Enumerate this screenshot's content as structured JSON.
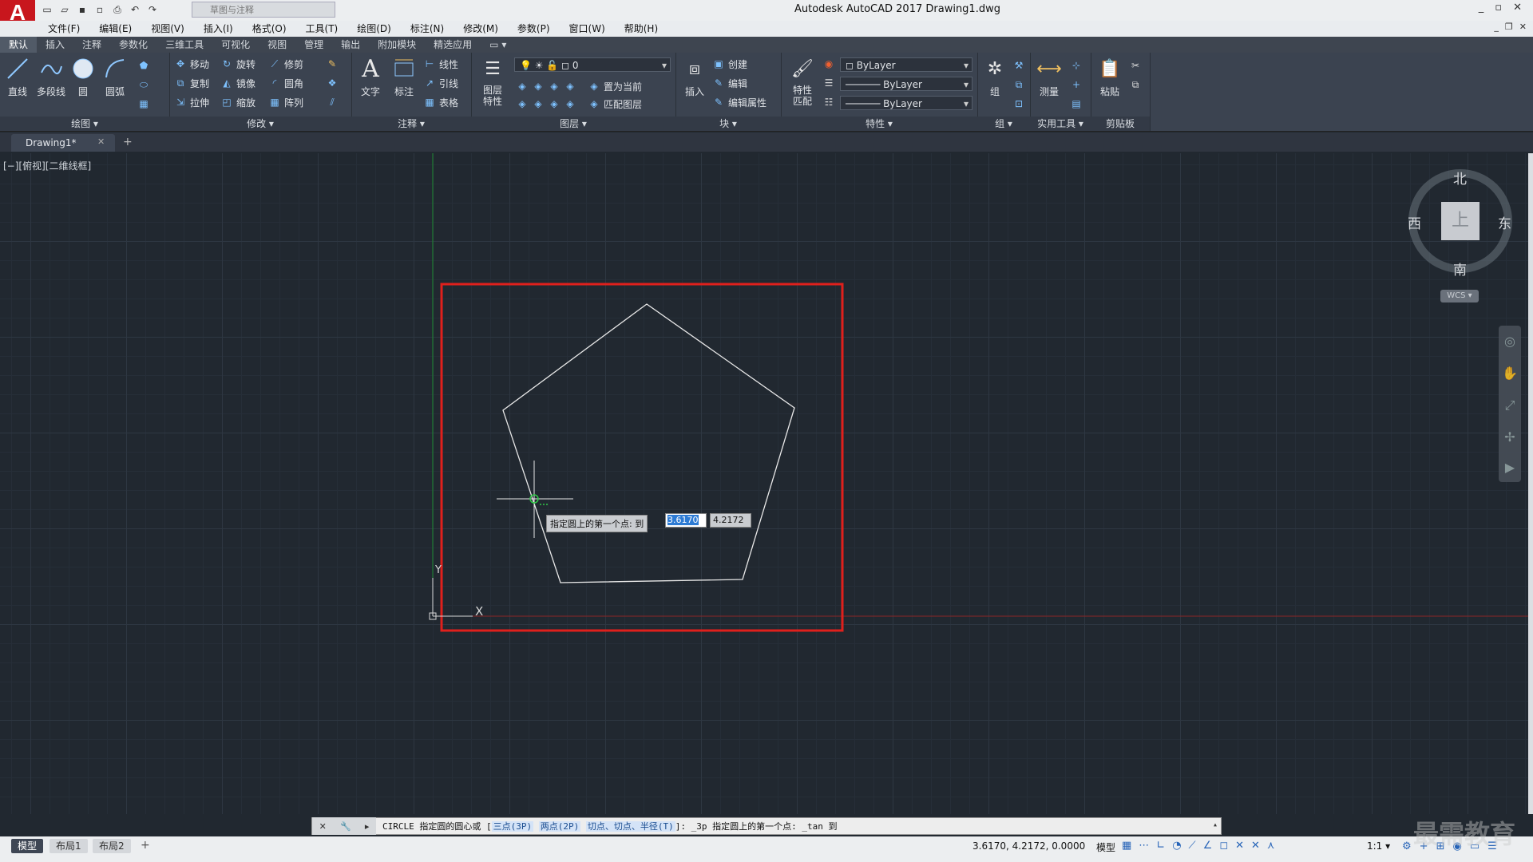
{
  "app": {
    "logo": "A",
    "title": "Autodesk AutoCAD 2017    Drawing1.dwg",
    "workspace": "草图与注释",
    "window_controls": [
      "_",
      "▫",
      "✕"
    ],
    "mdi_controls": [
      "_",
      "❐",
      "✕"
    ]
  },
  "menu": [
    "文件(F)",
    "编辑(E)",
    "视图(V)",
    "插入(I)",
    "格式(O)",
    "工具(T)",
    "绘图(D)",
    "标注(N)",
    "修改(M)",
    "参数(P)",
    "窗口(W)",
    "帮助(H)"
  ],
  "ribbon_tabs": [
    "默认",
    "插入",
    "注释",
    "参数化",
    "三维工具",
    "可视化",
    "视图",
    "管理",
    "输出",
    "附加模块",
    "精选应用"
  ],
  "ribbon_extra": "▭ ▾",
  "ribbon": {
    "draw": {
      "title": "绘图 ▾",
      "line": "直线",
      "polyline": "多段线",
      "circle": "圆",
      "arc": "圆弧"
    },
    "modify": {
      "title": "修改 ▾",
      "move": "移动",
      "rotate": "旋转",
      "trim": "修剪",
      "copy": "复制",
      "mirror": "镜像",
      "fillet": "圆角",
      "stretch": "拉伸",
      "scale": "缩放",
      "array": "阵列"
    },
    "annotation": {
      "title": "注释 ▾",
      "text": "文字",
      "dimension": "标注",
      "linear": "线性",
      "leader": "引线",
      "table": "表格"
    },
    "layers": {
      "title": "图层 ▾",
      "properties": "图层\n特性",
      "current_layer": "0",
      "set_current": "置为当前",
      "match_layer": "匹配图层"
    },
    "block": {
      "title": "块 ▾",
      "insert": "插入",
      "create": "创建",
      "edit": "编辑",
      "edit_attr": "编辑属性"
    },
    "properties": {
      "title": "特性 ▾",
      "match": "特性\n匹配",
      "color": "ByLayer",
      "linetype": "ByLayer",
      "lineweight": "ByLayer"
    },
    "groups": {
      "title": "组 ▾",
      "group": "组"
    },
    "utilities": {
      "title": "实用工具 ▾",
      "measure": "测量"
    },
    "clipboard": {
      "title": "剪贴板",
      "paste": "粘贴"
    }
  },
  "document": {
    "tab": "Drawing1*",
    "add": "+",
    "close": "✕"
  },
  "viewport": {
    "label": "[−][俯视][二维线框]"
  },
  "viewcube": {
    "north": "北",
    "south": "南",
    "east": "东",
    "west": "西",
    "top": "上",
    "wcs": "WCS ▾"
  },
  "ucs": {
    "x_label": "X",
    "y_label": "Y"
  },
  "dynamic_input": {
    "prompt": "指定圆上的第一个点: 到",
    "x_value": "3.6170",
    "y_value": "4.2172"
  },
  "command_line": {
    "prefix": "CIRCLE 指定圆的圆心或 [",
    "opt1": "三点(3P)",
    "opt2": "两点(2P)",
    "opt3": "切点、切点、半径(T)",
    "suffix": "]: _3p 指定圆上的第一个点: _tan 到",
    "expand": "▴"
  },
  "layout_tabs": [
    "模型",
    "布局1",
    "布局2"
  ],
  "layout_add": "+",
  "status": {
    "coords": "3.6170, 4.2172, 0.0000",
    "model": "模型",
    "scale": "1:1 ▾"
  },
  "watermark": "最需教育",
  "colors": {
    "canvas": "#212830",
    "highlight_frame": "#e0201c",
    "geometry": "#e8e8e8",
    "ribbon": "#3b4350"
  }
}
